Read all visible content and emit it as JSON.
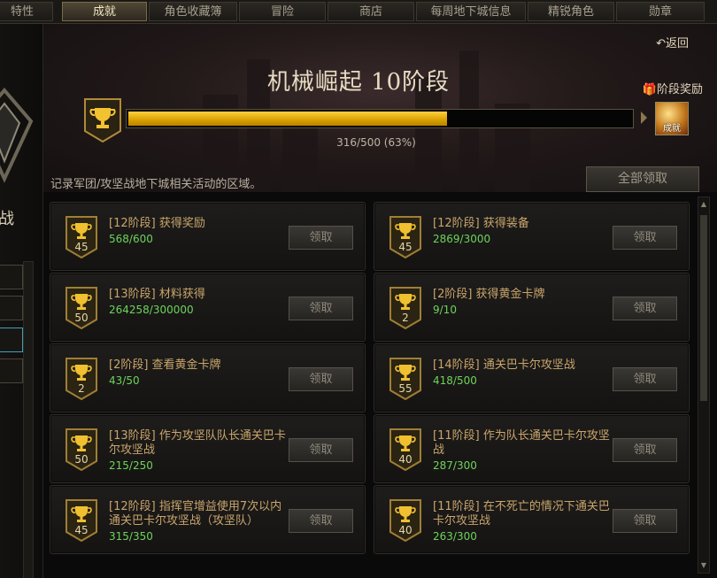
{
  "tabs": [
    {
      "label": "特性",
      "active": false
    },
    {
      "label": "成就",
      "active": true
    },
    {
      "label": "角色收藏簿",
      "active": false
    },
    {
      "label": "冒险",
      "active": false
    },
    {
      "label": "商店",
      "active": false
    },
    {
      "label": "每周地下城信息",
      "active": false
    },
    {
      "label": "精锐角色",
      "active": false
    },
    {
      "label": "勋章",
      "active": false
    }
  ],
  "left": {
    "glyph": "战"
  },
  "header": {
    "back_label": "返回",
    "title": "机械崛起 10阶段",
    "stage_reward_label": "阶段奖励",
    "reward_icon_label": "成就",
    "progress_current": 316,
    "progress_total": 500,
    "progress_text": "316/500 (63%)"
  },
  "description": "记录军团/攻坚战地下城相关活动的区域。",
  "claim_all_label": "全部领取",
  "achievements": [
    {
      "level": "45",
      "title": "[12阶段] 获得奖励",
      "progress": "568/600",
      "claim": "领取"
    },
    {
      "level": "45",
      "title": "[12阶段] 获得装备",
      "progress": "2869/3000",
      "claim": "领取"
    },
    {
      "level": "50",
      "title": "[13阶段] 材料获得",
      "progress": "264258/300000",
      "claim": "领取"
    },
    {
      "level": "2",
      "title": "[2阶段] 获得黄金卡牌",
      "progress": "9/10",
      "claim": "领取"
    },
    {
      "level": "2",
      "title": "[2阶段] 查看黄金卡牌",
      "progress": "43/50",
      "claim": "领取"
    },
    {
      "level": "55",
      "title": "[14阶段] 通关巴卡尔攻坚战",
      "progress": "418/500",
      "claim": "领取"
    },
    {
      "level": "50",
      "title": "[13阶段] 作为攻坚队队长通关巴卡尔攻坚战",
      "progress": "215/250",
      "claim": "领取"
    },
    {
      "level": "40",
      "title": "[11阶段] 作为队长通关巴卡尔攻坚战",
      "progress": "287/300",
      "claim": "领取"
    },
    {
      "level": "45",
      "title": "[12阶段] 指挥官增益使用7次以内通关巴卡尔攻坚战（攻坚队）",
      "progress": "315/350",
      "claim": "领取"
    },
    {
      "level": "40",
      "title": "[11阶段] 在不死亡的情况下通关巴卡尔攻坚战",
      "progress": "263/300",
      "claim": "领取"
    }
  ],
  "colors": {
    "accent": "#f5b800",
    "progress_green": "#6ed35a",
    "title_gold": "#c9a56c"
  }
}
